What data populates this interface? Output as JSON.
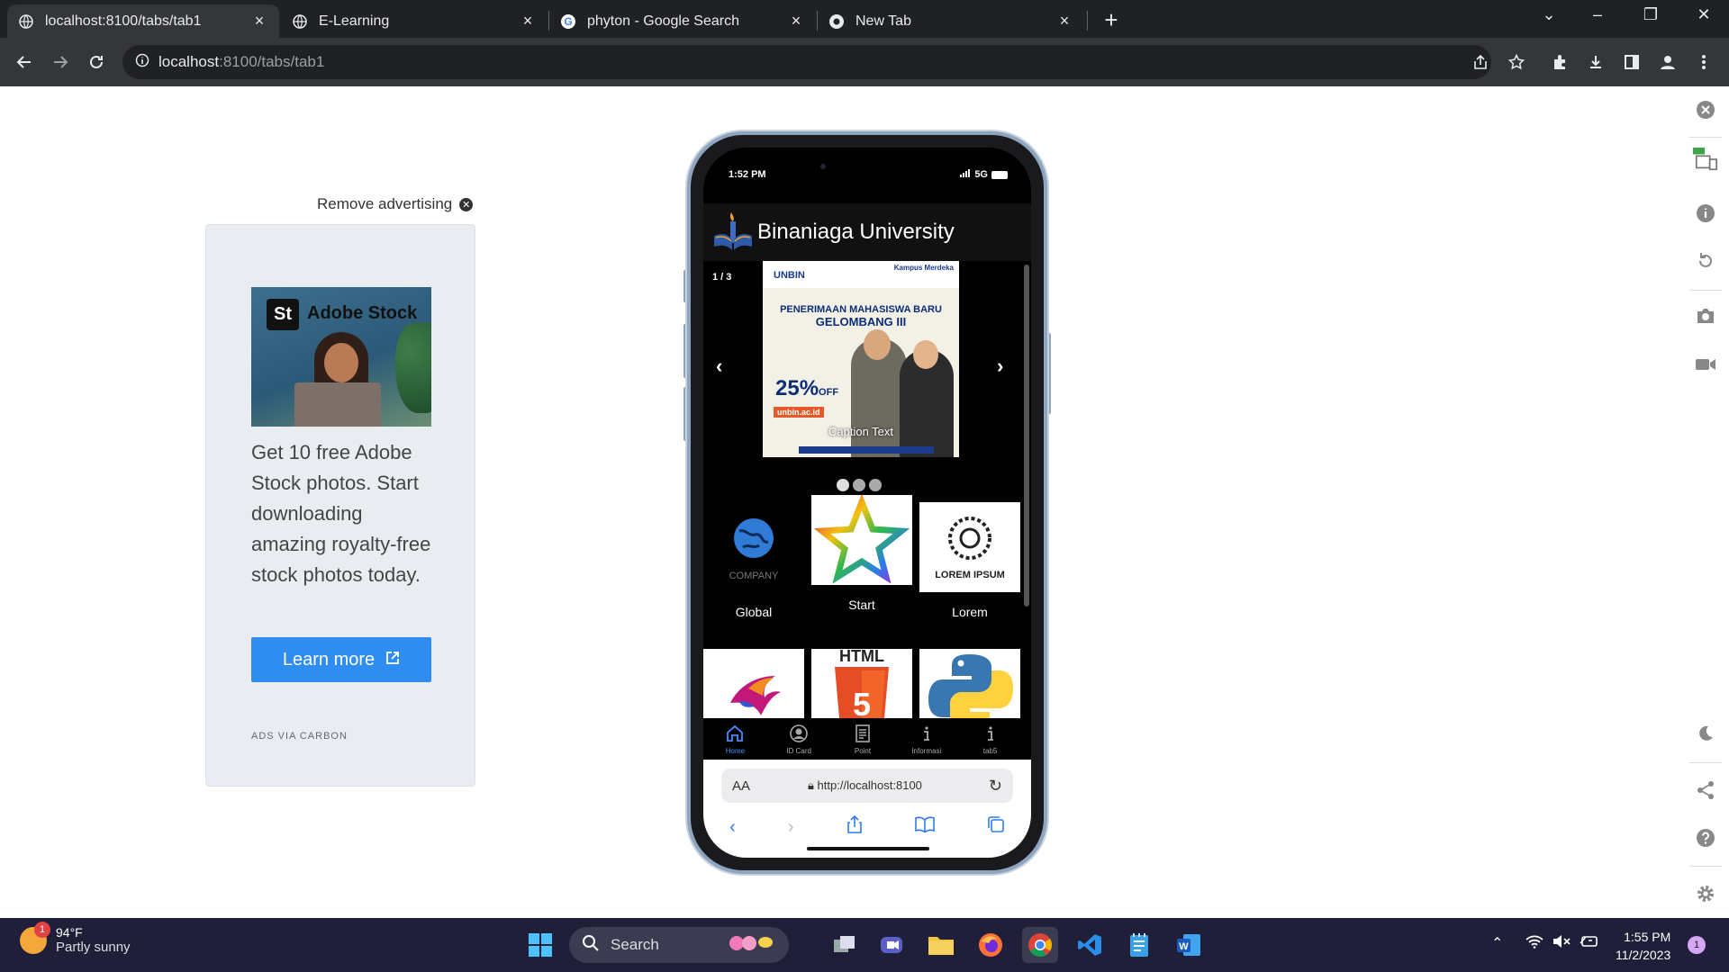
{
  "browser": {
    "tabs": [
      {
        "title": "localhost:8100/tabs/tab1",
        "favicon": "globe-icon",
        "active": true
      },
      {
        "title": "E-Learning",
        "favicon": "globe-icon",
        "active": false
      },
      {
        "title": "phyton - Google Search",
        "favicon": "google-icon",
        "active": false
      },
      {
        "title": "New Tab",
        "favicon": "chrome-icon",
        "active": false
      }
    ],
    "address": {
      "host": "localhost",
      "path": ":8100/tabs/tab1"
    }
  },
  "ad": {
    "remove_label": "Remove advertising",
    "brand_badge": "St",
    "brand_name": "Adobe Stock",
    "body": "Get 10 free Adobe Stock photos. Start downloading amazing royalty-free stock photos today.",
    "cta": "Learn more",
    "footer": "ADS VIA CARBON"
  },
  "phone": {
    "status": {
      "time": "1:52 PM",
      "network": "5G"
    },
    "app_title": "Binaniaga University",
    "slider": {
      "counter": "1 / 3",
      "caption": "Caption Text",
      "prev": "‹",
      "next": "›",
      "poster": {
        "brand": "UNBIN",
        "badge": "Kampus Merdeka",
        "headline": "PENERIMAAN MAHASISWA BARU",
        "wave": "GELOMBANG III",
        "discount": "25%",
        "discount_suffix": "OFF",
        "site": "unbin.ac.id"
      },
      "dots": 3,
      "active_dot": 1
    },
    "grid": [
      {
        "label": "Global",
        "logo_text": "COMPANY"
      },
      {
        "label": "Start"
      },
      {
        "label": "Lorem",
        "logo_text": "LOREM IPSUM"
      },
      {
        "label": ""
      },
      {
        "label": "",
        "logo_text": "HTML"
      },
      {
        "label": ""
      }
    ],
    "tabbar": [
      {
        "label": "Home",
        "icon": "home-icon",
        "active": true
      },
      {
        "label": "ID Card",
        "icon": "person-circle-icon",
        "active": false
      },
      {
        "label": "Point",
        "icon": "document-icon",
        "active": false
      },
      {
        "label": "Informasi",
        "icon": "info-icon",
        "active": false
      },
      {
        "label": "tab5",
        "icon": "info-icon",
        "active": false
      }
    ],
    "safari": {
      "aa": "AA",
      "url": "http://localhost:8100"
    }
  },
  "taskbar": {
    "weather": {
      "temp": "94°F",
      "desc": "Partly sunny",
      "badge": "1"
    },
    "search_label": "Search",
    "time": "1:55 PM",
    "date": "11/2/2023",
    "notifications": "1"
  }
}
